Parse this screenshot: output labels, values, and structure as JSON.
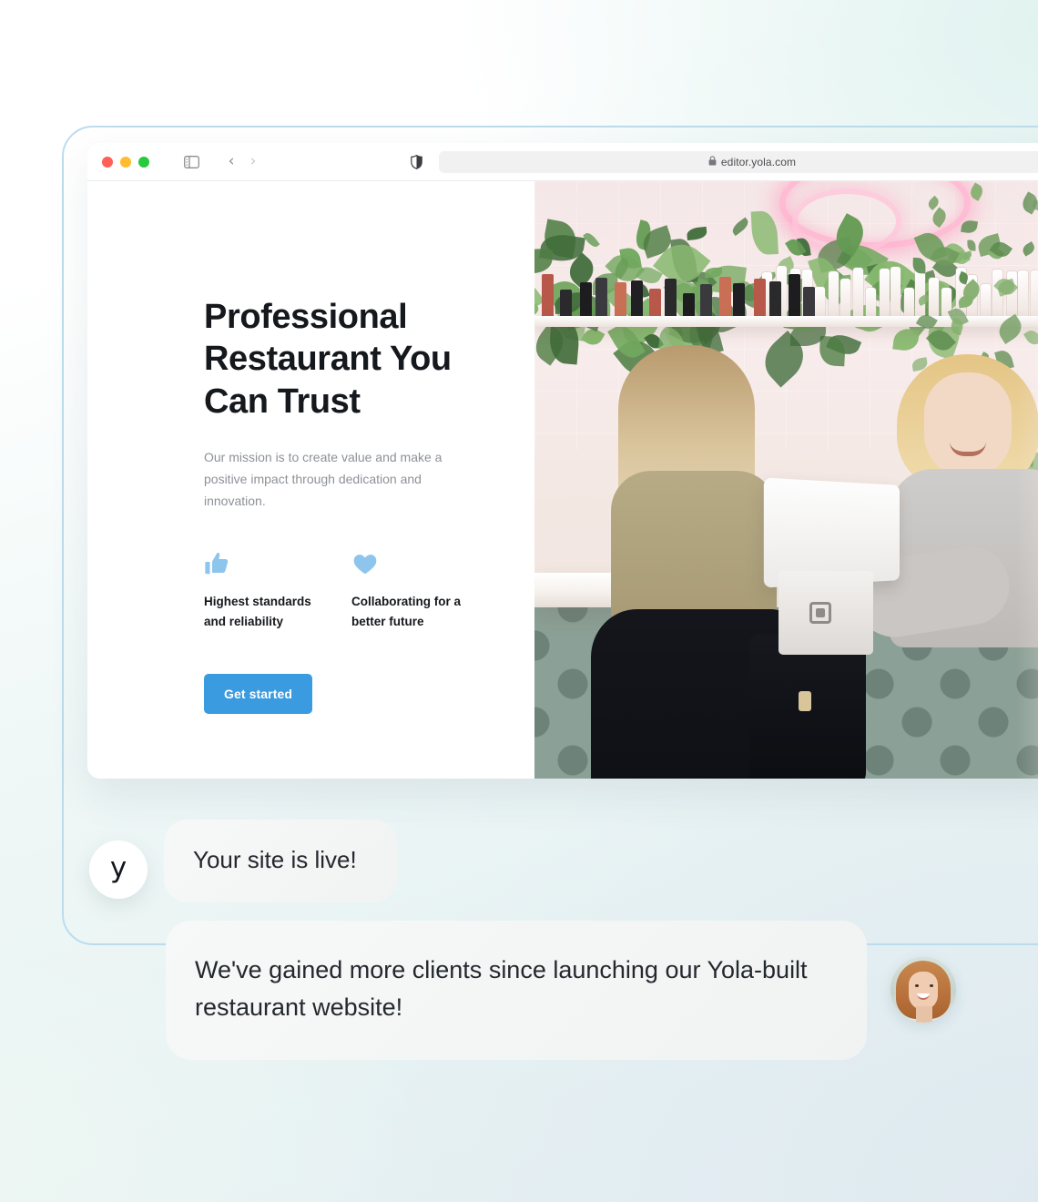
{
  "browser": {
    "traffic_lights": [
      "close-red",
      "minimize-yellow",
      "maximize-green"
    ],
    "sidebar_toggle_icon": "sidebar-toggle-icon",
    "back_label": "‹",
    "forward_label": "›",
    "shield_icon": "privacy-shield-icon",
    "lock_icon": "lock-icon",
    "url": "editor.yola.com",
    "reload_icon": "reload-icon"
  },
  "hero": {
    "title": "Professional Restaurant You Can Trust",
    "subtitle": "Our mission is to create value and make a positive impact through dedication and innovation.",
    "features": [
      {
        "icon": "thumbs-up-icon",
        "label": "Highest standards and reliability"
      },
      {
        "icon": "heart-icon",
        "label": "Collaborating for a better future"
      }
    ],
    "cta_label": "Get started",
    "photo_alt": "Two women at a shop counter with plants and a tablet point-of-sale"
  },
  "chat": {
    "agent": {
      "avatar_letter": "y",
      "message": "Your site is live!"
    },
    "user": {
      "message": "We've gained more clients since launching our Yola-built restaurant website!",
      "avatar_alt": "Smiling woman portrait"
    }
  },
  "colors": {
    "accent_blue": "#3b9be0",
    "icon_blue": "#8ec5ec",
    "frame_border": "#bcdcee",
    "heading": "#15181c",
    "body_text": "#8d9197",
    "bubble_bg": "#f3f5f5"
  }
}
